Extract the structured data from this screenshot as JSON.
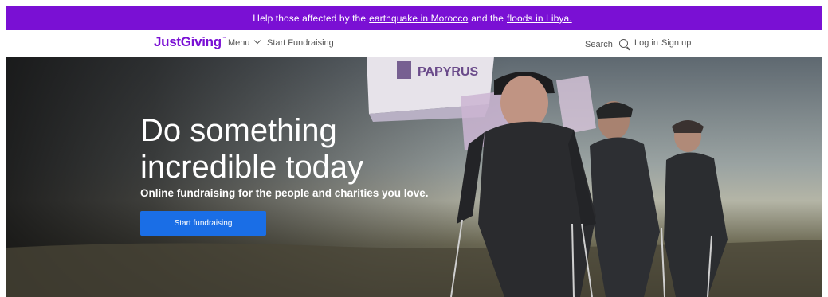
{
  "banner": {
    "prefix": "Help those affected by the",
    "link1": "earthquake in Morocco",
    "middle": "and the",
    "link2": "floods in Libya.",
    "background": "#7a10d4"
  },
  "header": {
    "logo": "JustGiving",
    "logo_mark": "™",
    "menu_label": "Menu",
    "start_fundraising": "Start Fundraising",
    "search_label": "Search",
    "login_label": "Log in",
    "signup_label": "Sign up",
    "brand_color": "#7a10d4"
  },
  "hero": {
    "title": "Do something\nincredible today",
    "subtitle": "Online fundraising for the people and charities you love.",
    "button_label": "Start fundraising",
    "button_color": "#1a6ee6",
    "flag_text": "PAPYRUS"
  },
  "icons": {
    "menu": "chevron-down-icon",
    "search": "search-icon"
  }
}
